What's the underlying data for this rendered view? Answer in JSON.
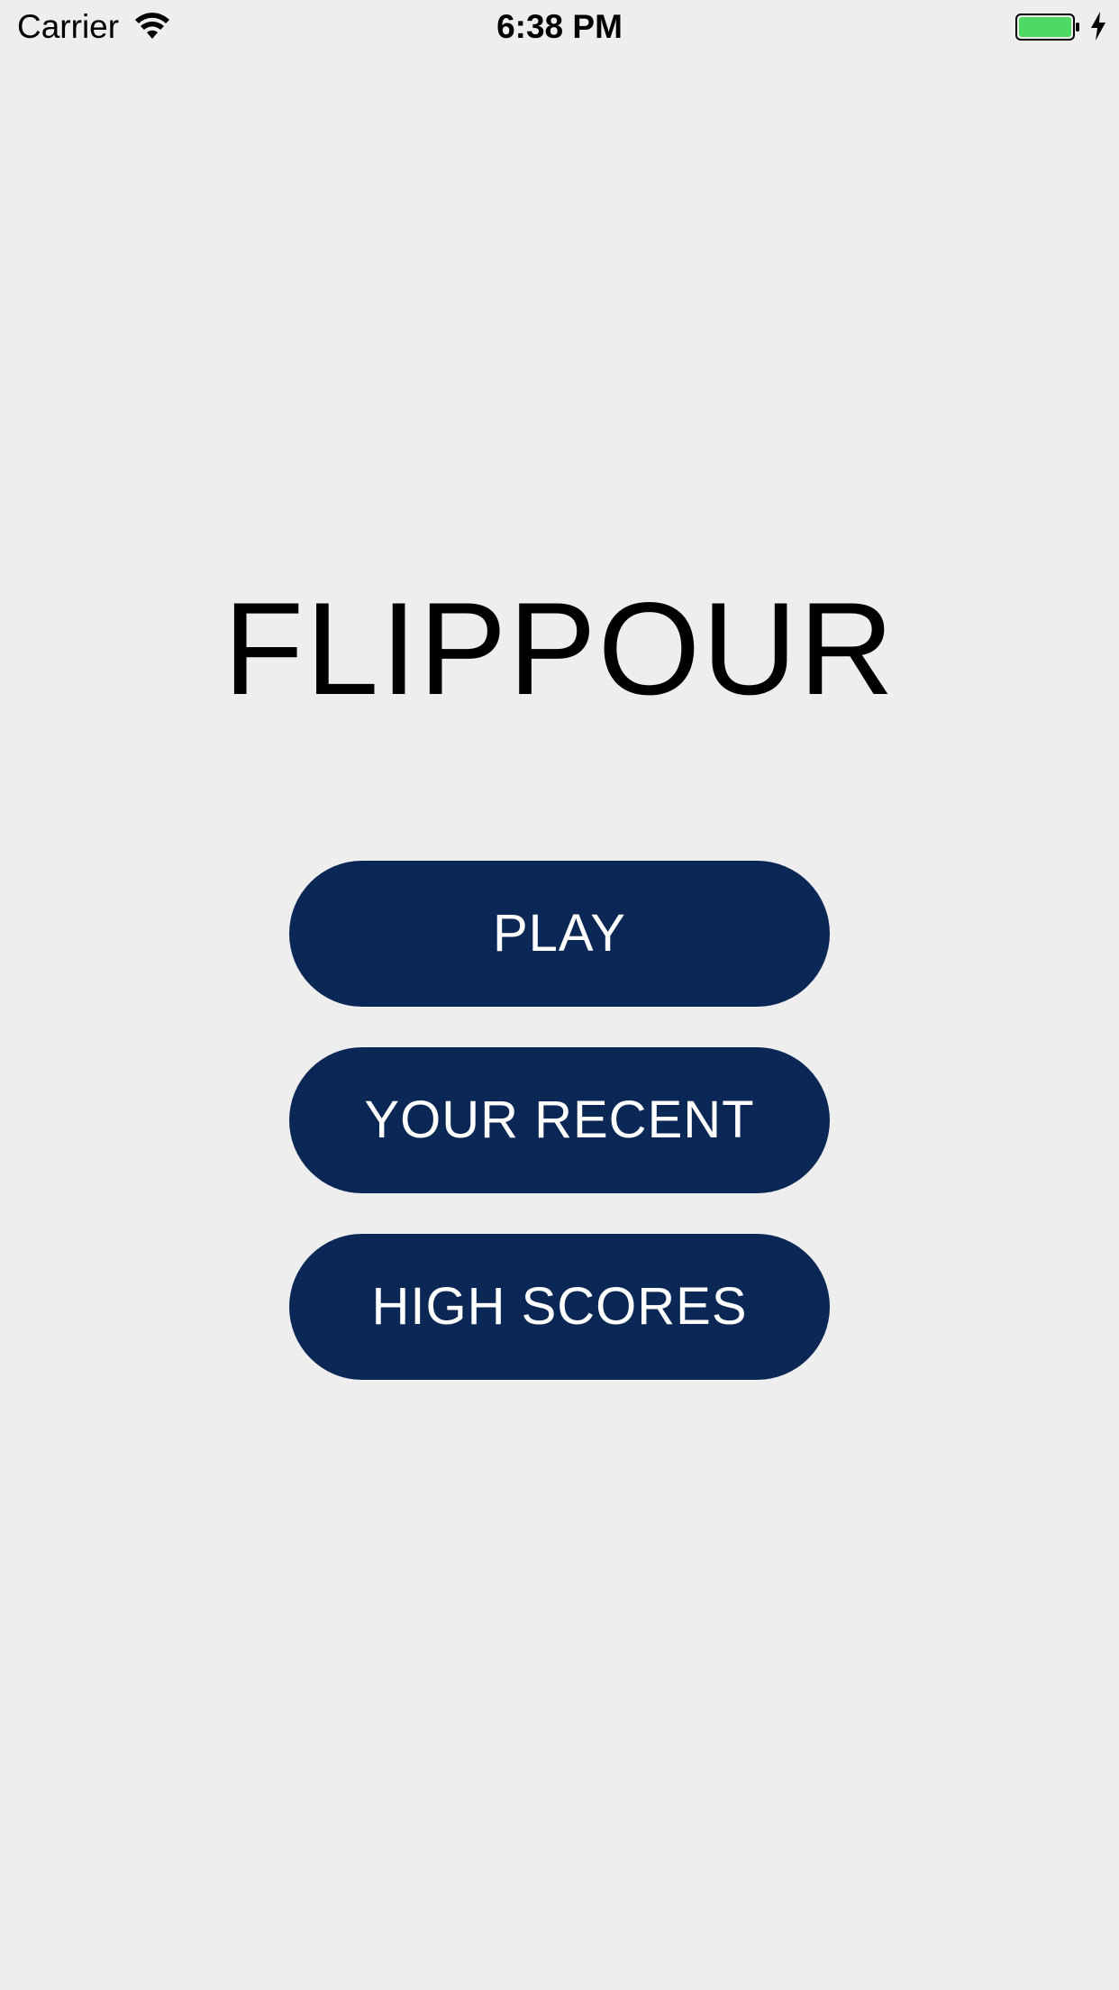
{
  "status_bar": {
    "carrier": "Carrier",
    "time": "6:38 PM",
    "battery_color": "#4cd964",
    "wifi_icon": "wifi-icon",
    "battery_icon": "battery-icon",
    "charging_icon": "charging-bolt-icon"
  },
  "app": {
    "title": "FLIPPOUR"
  },
  "menu": {
    "play_label": "PLAY",
    "recent_label": "YOUR RECENT",
    "high_scores_label": "HIGH SCORES",
    "button_color": "#0b2755"
  }
}
